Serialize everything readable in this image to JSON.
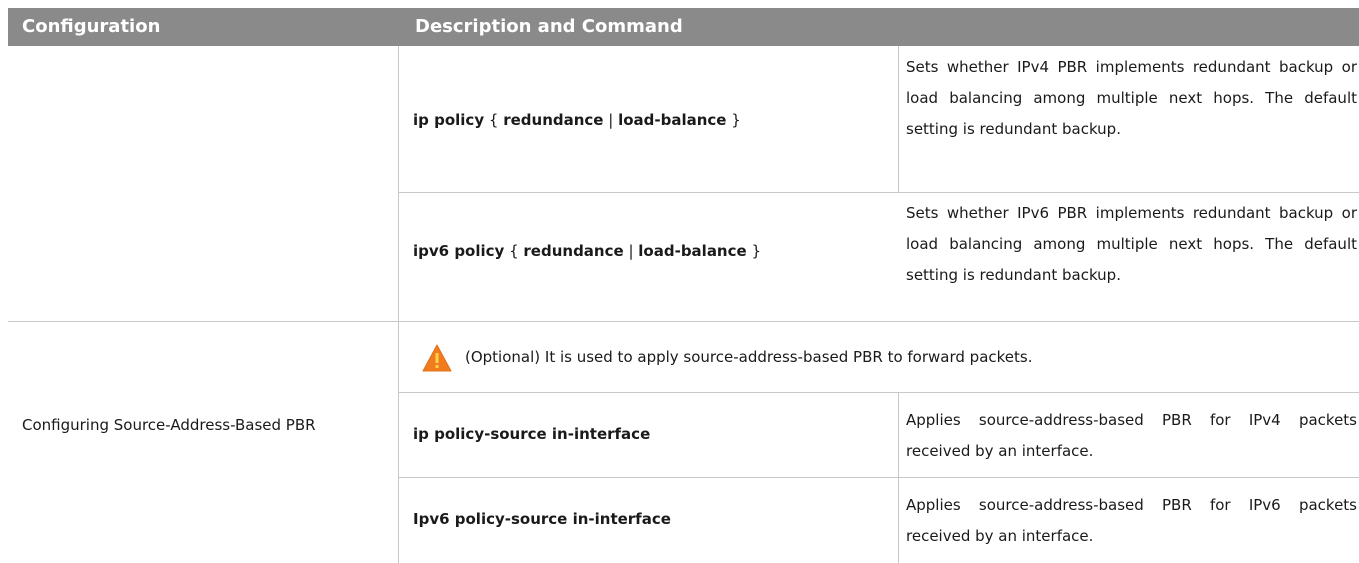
{
  "table": {
    "headers": {
      "configuration": "Configuration",
      "description_command": "Description and Command"
    },
    "rows": [
      {
        "cmd_prefix": "ip policy",
        "brace_open": " { ",
        "opt1": "redundance",
        "sep": " | ",
        "opt2": "load-balance",
        "brace_close": " }",
        "description": "Sets whether IPv4 PBR implements redundant backup or load balancing among multiple next hops. The default setting is redundant backup."
      },
      {
        "cmd_prefix": "ipv6 policy",
        "brace_open": " { ",
        "opt1": "redundance",
        "sep": " | ",
        "opt2": "load-balance",
        "brace_close": " }",
        "description": "Sets whether IPv6 PBR implements redundant backup or load balancing among multiple next hops. The default setting is redundant backup."
      }
    ],
    "source_section": {
      "configuration": "Configuring Source-Address-Based PBR",
      "note": "(Optional) It is used to apply source-address-based PBR to forward packets.",
      "note_icon": "warning-icon",
      "rows": [
        {
          "command": "ip policy-source in-interface",
          "description": "Applies source-address-based PBR for IPv4 packets received by an interface."
        },
        {
          "command": "Ipv6 policy-source in-interface",
          "description": "Applies source-address-based PBR for IPv6 packets received by an interface."
        }
      ]
    }
  },
  "colors": {
    "header_bg": "#8a8a8a",
    "header_text": "#ffffff",
    "rule": "#c8c8c8",
    "warning_orange": "#f07c1e"
  }
}
